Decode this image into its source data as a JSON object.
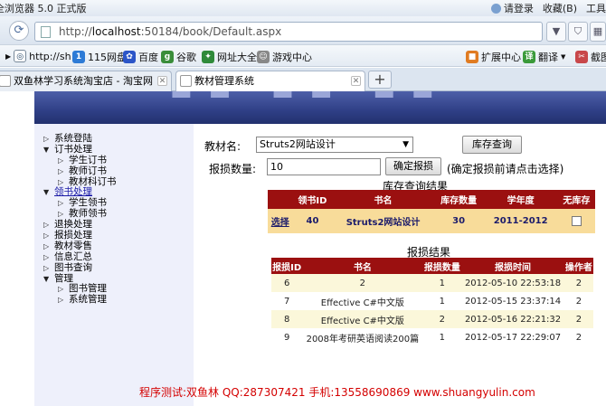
{
  "browser": {
    "title": "全浏览器 5.0 正式版",
    "login": "请登录",
    "favorites": "收藏(B)",
    "tools": "工具"
  },
  "address": {
    "scheme": "http://",
    "host": "localhost",
    "path": ":50184/book/Default.aspx"
  },
  "favorites": [
    "http://sh",
    "115网盘",
    "百度",
    "谷歌",
    "网址大全",
    "游戏中心",
    "扩展中心",
    "翻译",
    "截图"
  ],
  "tabs": [
    "双鱼林学习系统淘宝店 - 淘宝网",
    "教材管理系统"
  ],
  "nav": [
    {
      "label": "系统登陆",
      "level": 0,
      "arrow": "right"
    },
    {
      "label": "订书处理",
      "level": 0,
      "arrow": "down"
    },
    {
      "label": "学生订书",
      "level": 1,
      "arrow": "right"
    },
    {
      "label": "教师订书",
      "level": 1,
      "arrow": "right"
    },
    {
      "label": "教材科订书",
      "level": 1,
      "arrow": "right"
    },
    {
      "label": "领书处理",
      "level": 0,
      "arrow": "down",
      "link": true
    },
    {
      "label": "学生领书",
      "level": 1,
      "arrow": "right"
    },
    {
      "label": "教师领书",
      "level": 1,
      "arrow": "right"
    },
    {
      "label": "退换处理",
      "level": 0,
      "arrow": "right"
    },
    {
      "label": "报损处理",
      "level": 0,
      "arrow": "right"
    },
    {
      "label": "教材零售",
      "level": 0,
      "arrow": "right"
    },
    {
      "label": "信息汇总",
      "level": 0,
      "arrow": "right"
    },
    {
      "label": "图书查询",
      "level": 0,
      "arrow": "right"
    },
    {
      "label": "管理",
      "level": 0,
      "arrow": "down"
    },
    {
      "label": "图书管理",
      "level": 1,
      "arrow": "right"
    },
    {
      "label": "系统管理",
      "level": 1,
      "arrow": "right"
    }
  ],
  "form": {
    "name_label": "教材名:",
    "name_value": "Struts2网站设计",
    "query_button": "库存查询",
    "qty_label": "报损数量:",
    "qty_value": "10",
    "confirm_button": "确定报损",
    "hint": "(确定报损前请点击选择)"
  },
  "stock": {
    "caption": "库存查询结果",
    "headers": [
      "",
      "领书ID",
      "书名",
      "库存数量",
      "学年度",
      "无库存"
    ],
    "row": {
      "select": "选择",
      "id": "40",
      "name": "Struts2网站设计",
      "qty": "30",
      "year": "2011-2012",
      "no_stock": false
    }
  },
  "result": {
    "caption": "报损结果",
    "headers": [
      "报损ID",
      "书名",
      "报损数量",
      "报损时间",
      "操作者"
    ],
    "rows": [
      [
        "6",
        "2",
        "1",
        "2012-05-10 22:53:18",
        "2"
      ],
      [
        "7",
        "Effective C#中文版",
        "1",
        "2012-05-15 23:37:14",
        "2"
      ],
      [
        "8",
        "Effective C#中文版",
        "2",
        "2012-05-16 22:21:32",
        "2"
      ],
      [
        "9",
        "2008年考研英语阅读200篇",
        "1",
        "2012-05-17 22:29:07",
        "2"
      ]
    ]
  },
  "footer": "程序测试:双鱼林 QQ:287307421 手机:13558690869 www.shuangyulin.com"
}
